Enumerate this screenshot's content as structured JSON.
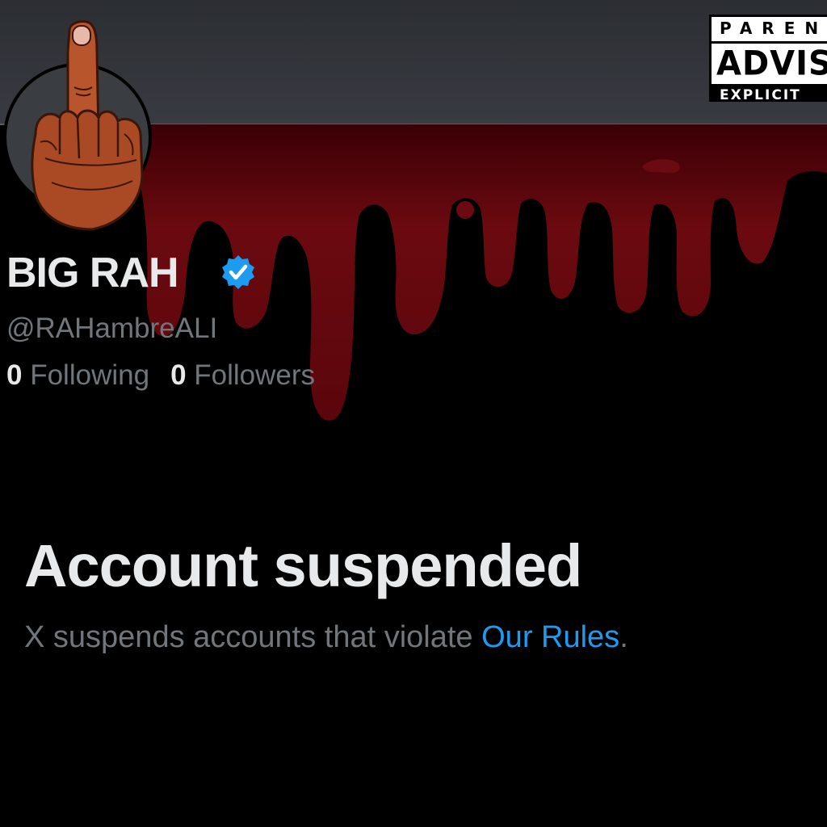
{
  "profile": {
    "display_name": "BIG RAH",
    "handle": "@RAHambreALI",
    "following_count": "0",
    "following_label": "Following",
    "followers_count": "0",
    "followers_label": "Followers"
  },
  "suspension": {
    "title": "Account suspended",
    "message_prefix": "X suspends accounts that violate ",
    "link_label": "Our Rules",
    "message_suffix": "."
  },
  "advisory": {
    "line1": "PARENT",
    "line2": "ADVISORY",
    "line3": "EXPLICIT CONTENT"
  },
  "icons": {
    "verified": "verified-badge-icon",
    "avatar": "middle-finger-hand"
  },
  "colors": {
    "background": "#000000",
    "banner": "#35383d",
    "blood": "#6b0a10",
    "verified": "#1d9bf0",
    "link": "#1d9bf0",
    "primary_text": "#e7e9ea",
    "secondary_text": "#71767b"
  }
}
